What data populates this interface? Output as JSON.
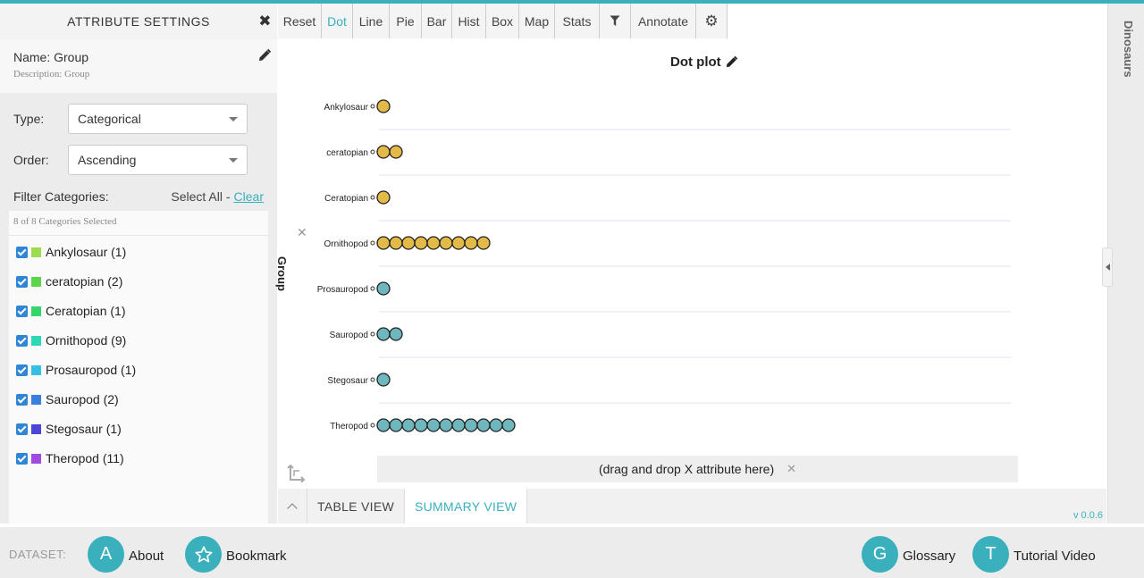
{
  "attribute_panel": {
    "title": "ATTRIBUTE SETTINGS",
    "name": "Name: Group",
    "description": "Description: Group",
    "type_label": "Type:",
    "type_value": "Categorical",
    "order_label": "Order:",
    "order_value": "Ascending",
    "filter_title": "Filter Categories:",
    "select_all": "Select All -",
    "clear": "Clear",
    "selected_count": "8 of 8 Categories Selected",
    "categories": [
      {
        "label": "Ankylosaur (1)",
        "color": "#9bdb4d",
        "checked": true
      },
      {
        "label": "ceratopian (2)",
        "color": "#5bd64a",
        "checked": true
      },
      {
        "label": "Ceratopian (1)",
        "color": "#34d66c",
        "checked": true
      },
      {
        "label": "Ornithopod (9)",
        "color": "#2fd8b4",
        "checked": true
      },
      {
        "label": "Prosauropod (1)",
        "color": "#33c0e2",
        "checked": true
      },
      {
        "label": "Sauropod (2)",
        "color": "#3a7fe0",
        "checked": true
      },
      {
        "label": "Stegosaur (1)",
        "color": "#4a46d6",
        "checked": true
      },
      {
        "label": "Theropod (11)",
        "color": "#a04be0",
        "checked": true
      }
    ]
  },
  "toolbar": {
    "items": [
      "Reset",
      "Dot",
      "Line",
      "Pie",
      "Bar",
      "Hist",
      "Box",
      "Map",
      "Stats",
      "filter-icon",
      "Annotate",
      "gear-icon"
    ],
    "active": "Dot"
  },
  "plot": {
    "title": "Dot plot",
    "y_attribute": "Group",
    "x_drop_text": "(drag and drop X attribute here)"
  },
  "chart_data": {
    "type": "scatter",
    "title": "Dot plot",
    "ylabel": "Group",
    "xlabel": "",
    "categories": [
      "Ankylosaur",
      "ceratopian",
      "Ceratopian",
      "Ornithopod",
      "Prosauropod",
      "Sauropod",
      "Stegosaur",
      "Theropod"
    ],
    "counts": [
      1,
      2,
      1,
      9,
      1,
      2,
      1,
      11
    ],
    "dot_colors": [
      "#e3b948",
      "#e3b948",
      "#e3b948",
      "#e3b948",
      "#6eb7bf",
      "#6eb7bf",
      "#6eb7bf",
      "#6eb7bf"
    ]
  },
  "right_panel": {
    "label": "Dinosaurs"
  },
  "views": {
    "tabs": [
      "TABLE VIEW",
      "SUMMARY VIEW"
    ],
    "active": "SUMMARY VIEW",
    "version": "v 0.0.6"
  },
  "footer": {
    "dataset_label": "DATASET:",
    "about_letter": "A",
    "about": "About",
    "bookmark": "Bookmark",
    "glossary_letter": "G",
    "glossary": "Glossary",
    "tutorial_letter": "T",
    "tutorial": "Tutorial Video"
  }
}
